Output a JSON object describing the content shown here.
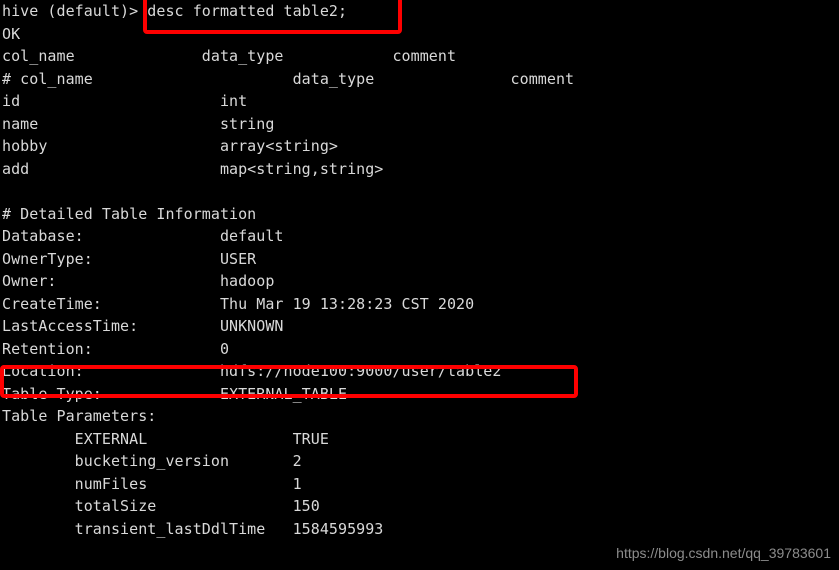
{
  "terminal": {
    "app": "hive-cli",
    "background_color": "#000000",
    "text_color": "#d9d9d9",
    "highlight_color": "#fe0000",
    "prompt": "hive (default)>",
    "command": " desc formatted table2;",
    "lines": [
      "hive (default)> desc formatted table2;",
      "OK",
      "col_name              data_type            comment",
      "# col_name             \t        data_type               comment",
      "id                      int",
      "name                    string",
      "hobby                   array<string>",
      "add                     map<string,string>",
      "",
      "# Detailed Table Information",
      "Database:               default",
      "OwnerType:              USER",
      "Owner:                  hadoop",
      "CreateTime:             Thu Mar 19 13:28:23 CST 2020",
      "LastAccessTime:         UNKNOWN",
      "Retention:              0",
      "Location:               hdfs://node100:9000/user/table2",
      "Table Type:             EXTERNAL_TABLE",
      "Table Parameters:",
      "        EXTERNAL                TRUE",
      "        bucketing_version       2",
      "        numFiles                1",
      "        totalSize               150",
      "        transient_lastDdlTime   1584595993"
    ],
    "status_ok": "OK",
    "header_row": {
      "col_name": "col_name",
      "data_type": "data_type",
      "comment": "comment"
    },
    "columns": [
      {
        "name": "id",
        "type": "int",
        "comment": ""
      },
      {
        "name": "name",
        "type": "string",
        "comment": ""
      },
      {
        "name": "hobby",
        "type": "array<string>",
        "comment": ""
      },
      {
        "name": "add",
        "type": "map<string,string>",
        "comment": ""
      }
    ],
    "detailed_section_title": "# Detailed Table Information",
    "details": [
      {
        "key": "Database:",
        "value": "default"
      },
      {
        "key": "OwnerType:",
        "value": "USER"
      },
      {
        "key": "Owner:",
        "value": "hadoop"
      },
      {
        "key": "CreateTime:",
        "value": "Thu Mar 19 13:28:23 CST 2020"
      },
      {
        "key": "LastAccessTime:",
        "value": "UNKNOWN"
      },
      {
        "key": "Retention:",
        "value": "0"
      },
      {
        "key": "Location:",
        "value": "hdfs://node100:9000/user/table2"
      },
      {
        "key": "Table Type:",
        "value": "EXTERNAL_TABLE"
      }
    ],
    "table_parameters_title": "Table Parameters:",
    "table_parameters": [
      {
        "key": "EXTERNAL",
        "value": "TRUE"
      },
      {
        "key": "bucketing_version",
        "value": "2"
      },
      {
        "key": "numFiles",
        "value": "1"
      },
      {
        "key": "totalSize",
        "value": "150"
      },
      {
        "key": "transient_lastDdlTime",
        "value": "1584595993"
      }
    ],
    "highlights": [
      {
        "target": "desc formatted table2;",
        "reason": "command"
      },
      {
        "target": "Location: hdfs://node100:9000/user/table2",
        "reason": "location-row"
      }
    ]
  },
  "watermark": {
    "text": "https://blog.csdn.net/qq_39783601"
  }
}
